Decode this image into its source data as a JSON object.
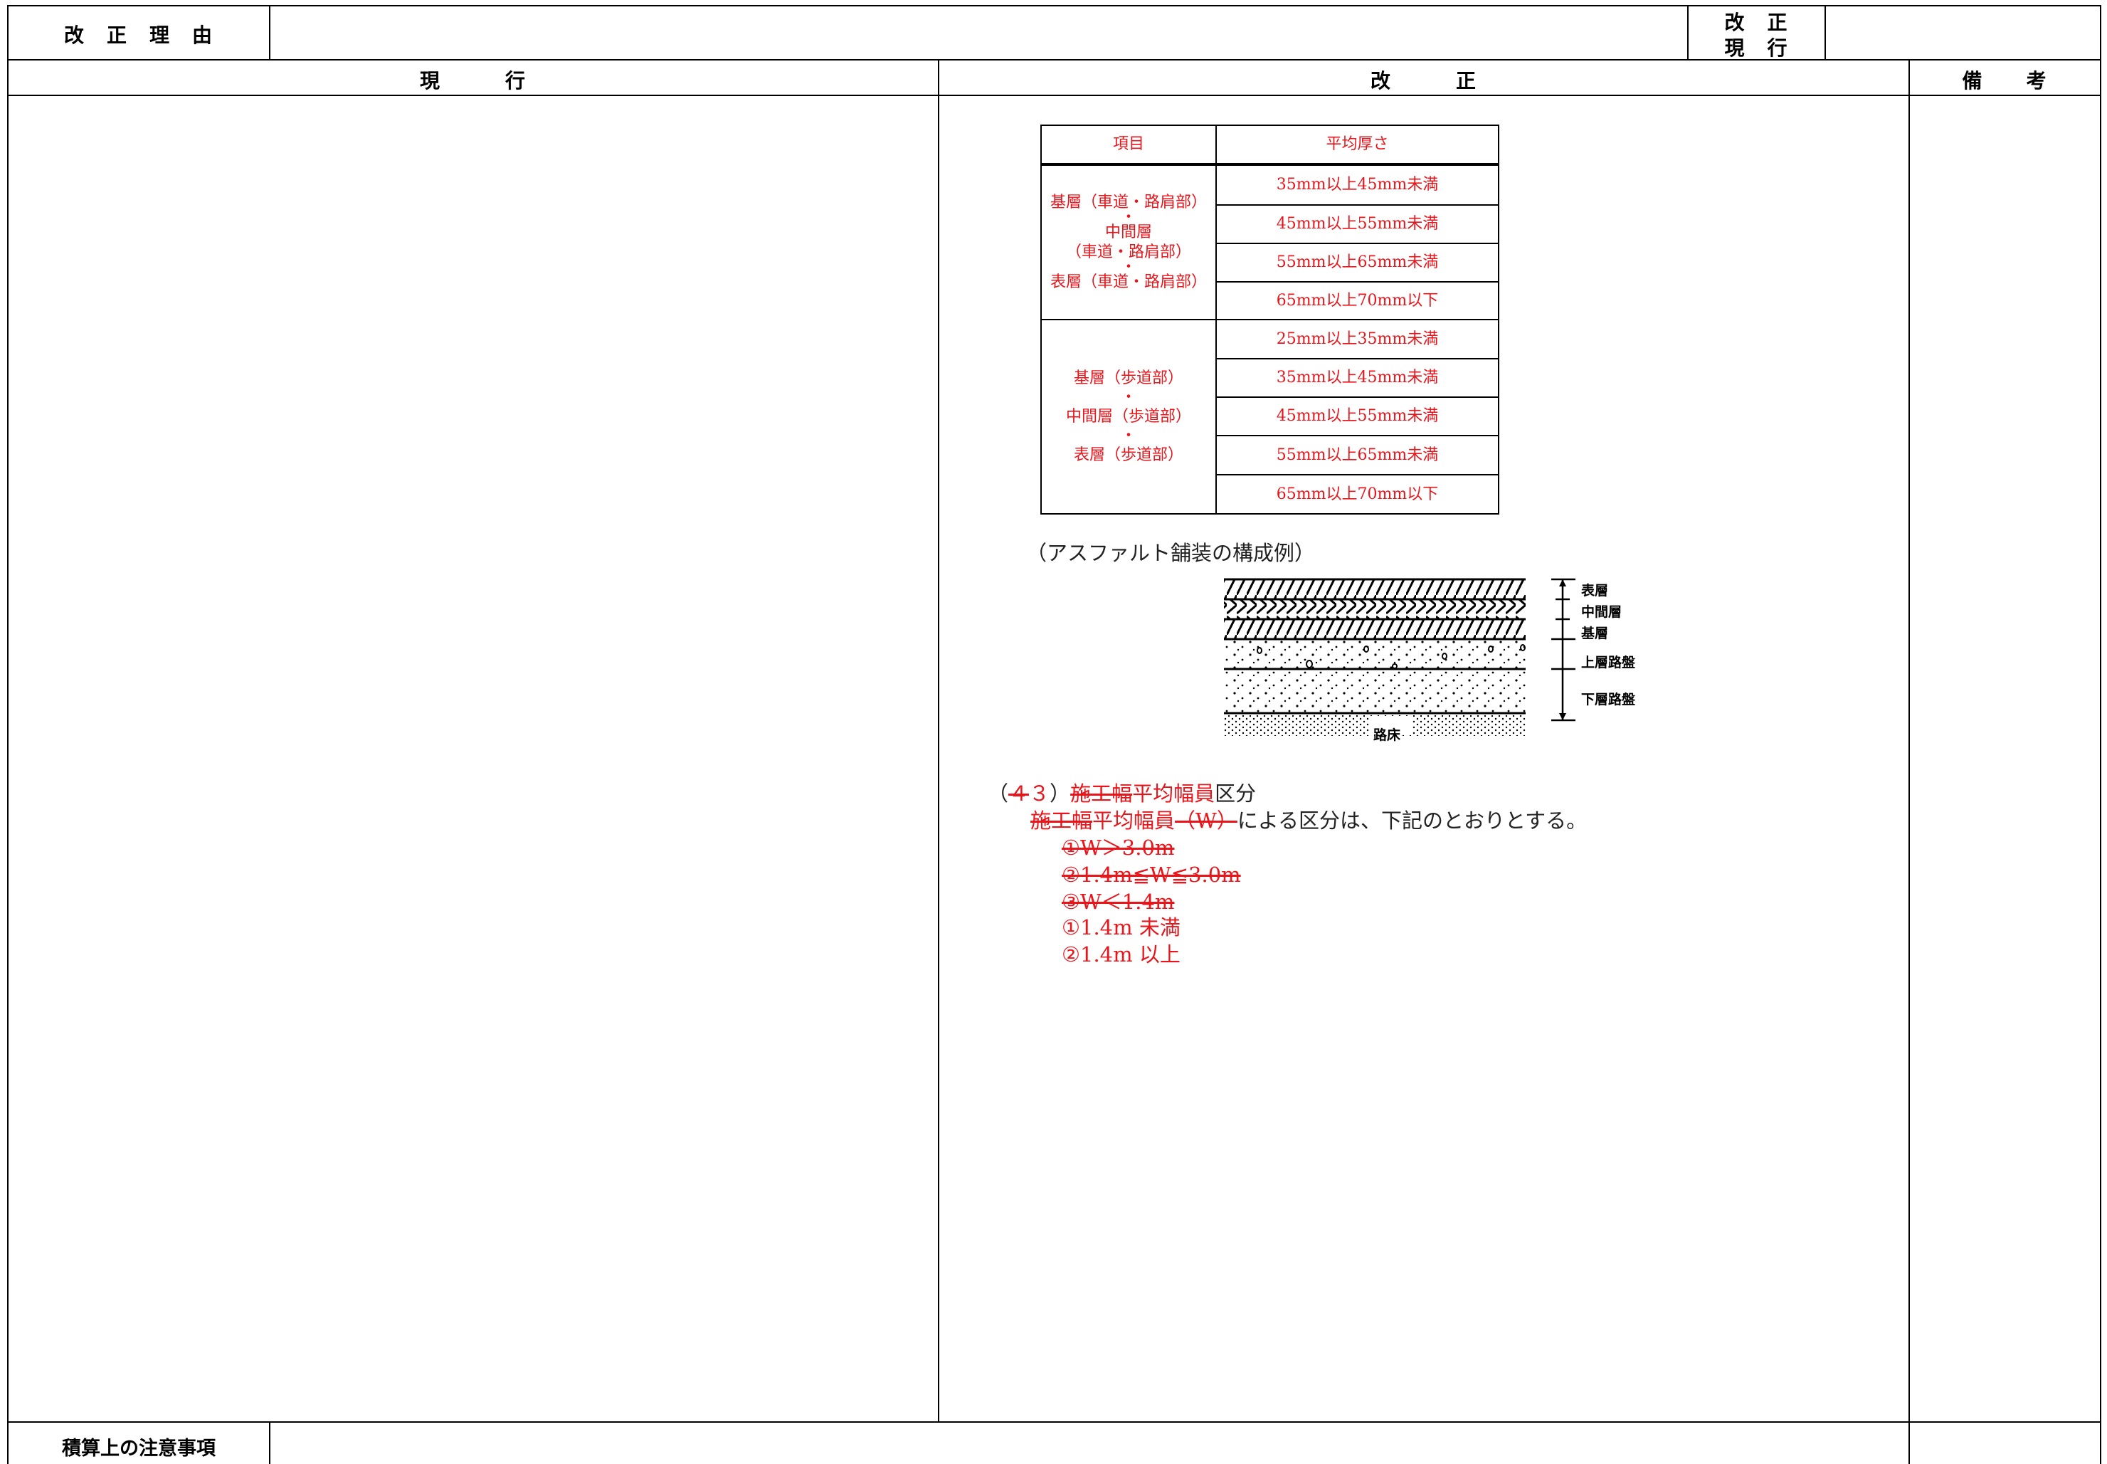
{
  "header": {
    "reason_label": "改　正　理　由",
    "revision_label_line1": "改　正",
    "revision_label_line2": "現　行",
    "col_current": "現　　　行",
    "col_revised": "改　　　正",
    "col_remarks": "備　　考"
  },
  "footer": {
    "notes_label": "積算上の注意事項"
  },
  "thickness_table": {
    "col_item": "項目",
    "col_thickness": "平均厚さ",
    "group1": {
      "lines": [
        "基層（車道・路肩部）",
        "・",
        "中間層",
        "（車道・路肩部）",
        "・",
        "表層（車道・路肩部）"
      ],
      "rows": [
        "35mm以上45mm未満",
        "45mm以上55mm未満",
        "55mm以上65mm未満",
        "65mm以上70mm以下"
      ]
    },
    "group2": {
      "lines": [
        "基層（歩道部）",
        "・",
        "中間層（歩道部）",
        "・",
        "表層（歩道部）"
      ],
      "rows": [
        "25mm以上35mm未満",
        "35mm以上45mm未満",
        "45mm以上55mm未満",
        "55mm以上65mm未満",
        "65mm以上70mm以下"
      ]
    }
  },
  "diagram": {
    "caption": "（アスファルト舗装の構成例）",
    "layers": [
      "表層",
      "中間層",
      "基層",
      "上層路盤",
      "下層路盤"
    ],
    "subgrade": "路床"
  },
  "section": {
    "heading_open": "（",
    "heading_old_no": "４",
    "heading_new_no": "３",
    "heading_close": "）",
    "heading_old_word": "施工幅",
    "heading_new_word": "平均幅員",
    "heading_tail": "区分",
    "line2_old_word": "施工幅",
    "line2_new_word": "平均幅員",
    "line2_deleted": "（W）",
    "line2_tail": "による区分は、下記のとおりとする。",
    "deleted_items": [
      "①W＞3.0m",
      "②1.4m≦W≦3.0m",
      "③W＜1.4m"
    ],
    "new_items": [
      "①1.4m 未満",
      "②1.4m 以上"
    ]
  }
}
